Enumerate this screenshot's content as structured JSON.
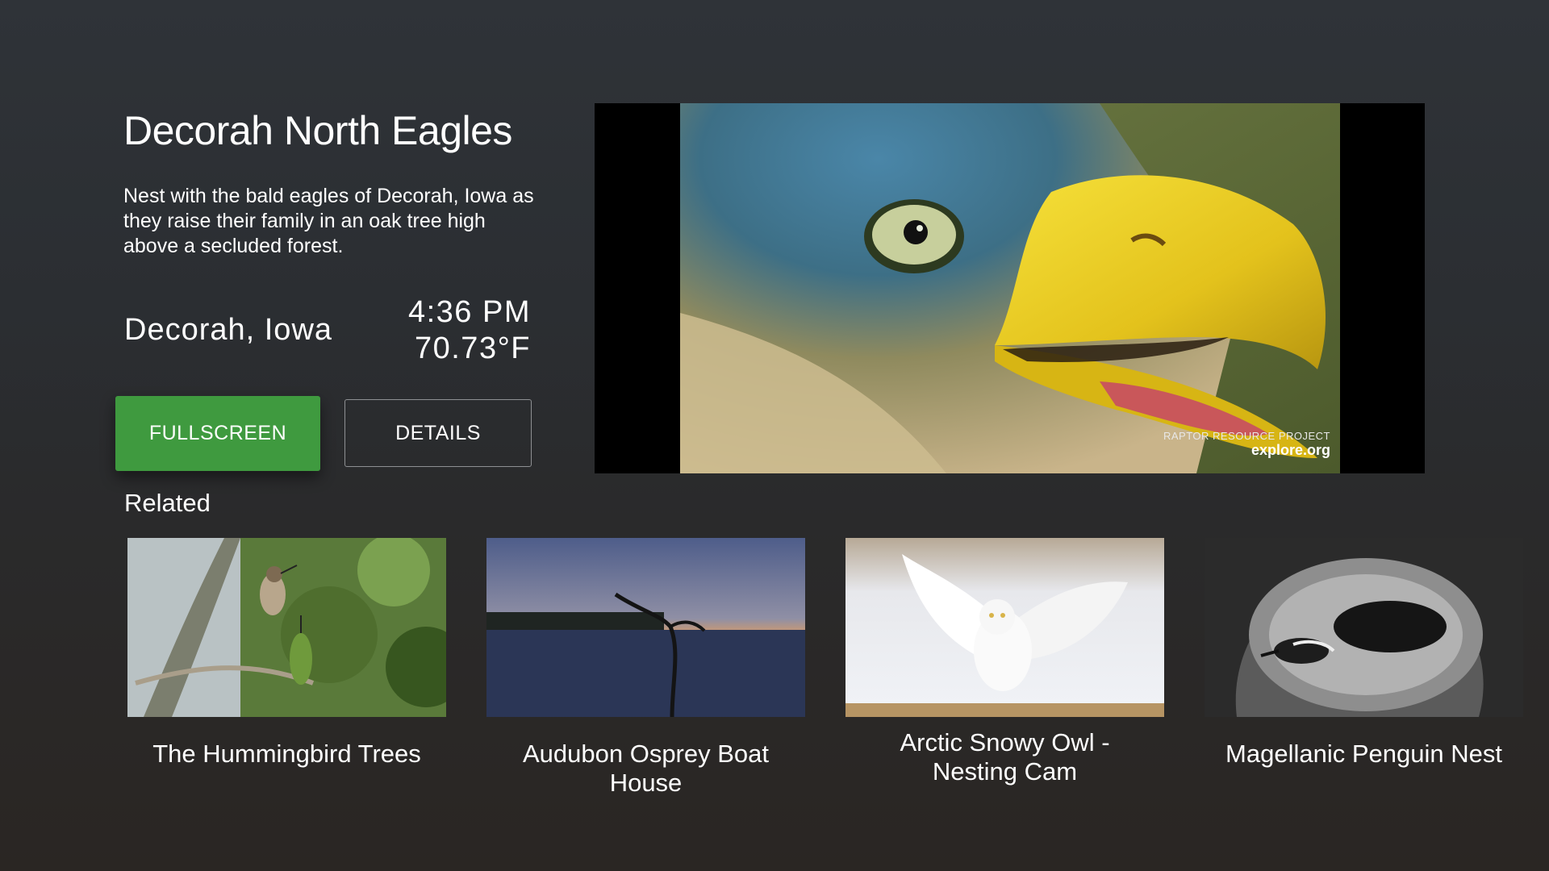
{
  "feature": {
    "title": "Decorah North Eagles",
    "description": "Nest with the bald eagles of Decorah, Iowa as they raise their family in an oak tree high above a secluded forest.",
    "location": "Decorah, Iowa",
    "time": "4:36 PM",
    "temperature": "70.73°F"
  },
  "buttons": {
    "fullscreen": "FULLSCREEN",
    "details": "DETAILS"
  },
  "player": {
    "watermark_line1": "RAPTOR RESOURCE PROJECT",
    "watermark_line2": "explore.org"
  },
  "related": {
    "heading": "Related",
    "items": [
      {
        "title": "The Hummingbird Trees"
      },
      {
        "title": "Audubon Osprey Boat House"
      },
      {
        "title": "Arctic Snowy Owl -\nNesting Cam"
      },
      {
        "title": "Magellanic Penguin Nest"
      }
    ]
  },
  "colors": {
    "primary_button": "#3f9a3f",
    "background": "#2f3338"
  }
}
